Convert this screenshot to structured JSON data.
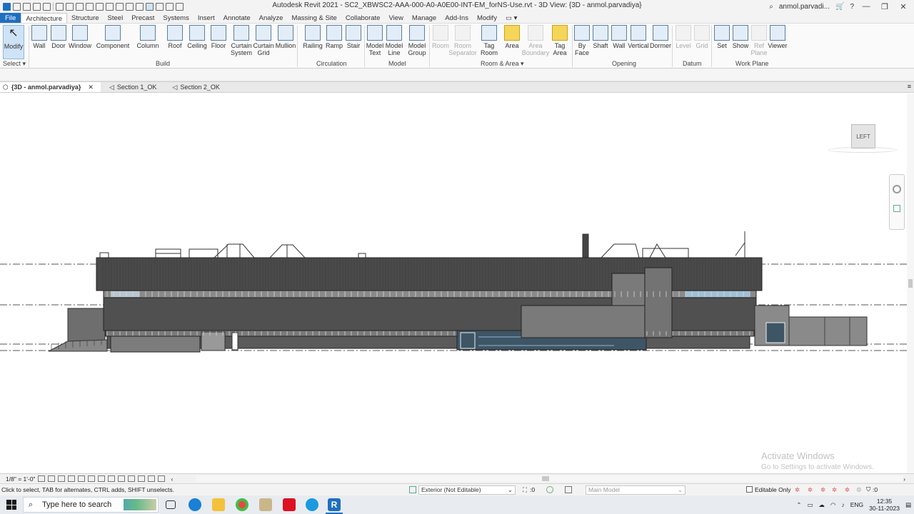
{
  "window": {
    "title": "Autodesk Revit 2021 - SC2_XBWSC2-AAA-000-A0-A0E00-INT-EM_forNS-Use.rvt - 3D View: {3D - anmol.parvadiya}",
    "user": "anmol.parvadi...",
    "minimize": "—",
    "restore": "❐",
    "close": "✕"
  },
  "ribbon_tabs": [
    "File",
    "Architecture",
    "Structure",
    "Steel",
    "Precast",
    "Systems",
    "Insert",
    "Annotate",
    "Analyze",
    "Massing & Site",
    "Collaborate",
    "View",
    "Manage",
    "Add-Ins",
    "Modify"
  ],
  "ribbon_tab_extra": "▭ ▾",
  "ribbon": {
    "buttons": [
      {
        "label": "Modify",
        "icon": "cursor-icon"
      },
      {
        "label": "Wall",
        "icon": "wall-icon"
      },
      {
        "label": "Door",
        "icon": "door-icon"
      },
      {
        "label": "Window",
        "icon": "window-icon"
      },
      {
        "label": "Component",
        "icon": "component-icon"
      },
      {
        "label": "Column",
        "icon": "column-icon"
      },
      {
        "label": "Roof",
        "icon": "roof-icon"
      },
      {
        "label": "Ceiling",
        "icon": "ceiling-icon"
      },
      {
        "label": "Floor",
        "icon": "floor-icon"
      },
      {
        "label": "Curtain\nSystem",
        "icon": "curtain-system-icon"
      },
      {
        "label": "Curtain\nGrid",
        "icon": "curtain-grid-icon"
      },
      {
        "label": "Mullion",
        "icon": "mullion-icon"
      },
      {
        "label": "Railing",
        "icon": "railing-icon"
      },
      {
        "label": "Ramp",
        "icon": "ramp-icon"
      },
      {
        "label": "Stair",
        "icon": "stair-icon"
      },
      {
        "label": "Model\nText",
        "icon": "model-text-icon"
      },
      {
        "label": "Model\nLine",
        "icon": "model-line-icon"
      },
      {
        "label": "Model\nGroup",
        "icon": "model-group-icon"
      },
      {
        "label": "Room",
        "icon": "room-icon",
        "disabled": true
      },
      {
        "label": "Room\nSeparator",
        "icon": "room-separator-icon",
        "disabled": true
      },
      {
        "label": "Tag\nRoom",
        "icon": "tag-room-icon"
      },
      {
        "label": "Area",
        "icon": "area-icon"
      },
      {
        "label": "Area\nBoundary",
        "icon": "area-boundary-icon",
        "disabled": true
      },
      {
        "label": "Tag\nArea",
        "icon": "tag-area-icon"
      },
      {
        "label": "By\nFace",
        "icon": "by-face-icon"
      },
      {
        "label": "Shaft",
        "icon": "shaft-icon"
      },
      {
        "label": "Wall",
        "icon": "opening-wall-icon"
      },
      {
        "label": "Vertical",
        "icon": "vertical-icon"
      },
      {
        "label": "Dormer",
        "icon": "dormer-icon"
      },
      {
        "label": "Level",
        "icon": "level-icon",
        "disabled": true
      },
      {
        "label": "Grid",
        "icon": "grid-icon",
        "disabled": true
      },
      {
        "label": "Set",
        "icon": "set-icon"
      },
      {
        "label": "Show",
        "icon": "show-icon"
      },
      {
        "label": "Ref\nPlane",
        "icon": "ref-plane-icon",
        "disabled": true
      },
      {
        "label": "Viewer",
        "icon": "viewer-icon"
      }
    ],
    "panels": [
      "Select ▾",
      "Build",
      "Circulation",
      "Model",
      "Room & Area ▾",
      "Opening",
      "Datum",
      "Work Plane"
    ]
  },
  "view_tabs": [
    {
      "label": "{3D - anmol.parvadiya}",
      "active": true,
      "close": "✕"
    },
    {
      "label": "Section 1_OK",
      "active": false
    },
    {
      "label": "Section 2_OK",
      "active": false
    }
  ],
  "view_cube": {
    "face": "LEFT"
  },
  "watermark": {
    "line1": "Activate Windows",
    "line2": "Go to Settings to activate Windows."
  },
  "view_control": {
    "scale": "1/8\" = 1'-0\""
  },
  "status": {
    "hint": "Click to select, TAB for alternates, CTRL adds, SHIFT unselects.",
    "workset_value": "Exterior (Not Editable)",
    "selection_count": ":0",
    "design_option": "Main Model",
    "editable_only": "Editable Only",
    "filter_count": ":0"
  },
  "taskbar": {
    "search_placeholder": "Type here to search",
    "lang": "ENG",
    "time": "12:35",
    "date": "30-11-2023"
  },
  "colors": {
    "file_tab": "#1f6fc0",
    "facade_dark": "#4a4a4a",
    "facade_mid": "#6e6e6e",
    "glazing": "#8fb3cf",
    "level_line": "#555555"
  }
}
